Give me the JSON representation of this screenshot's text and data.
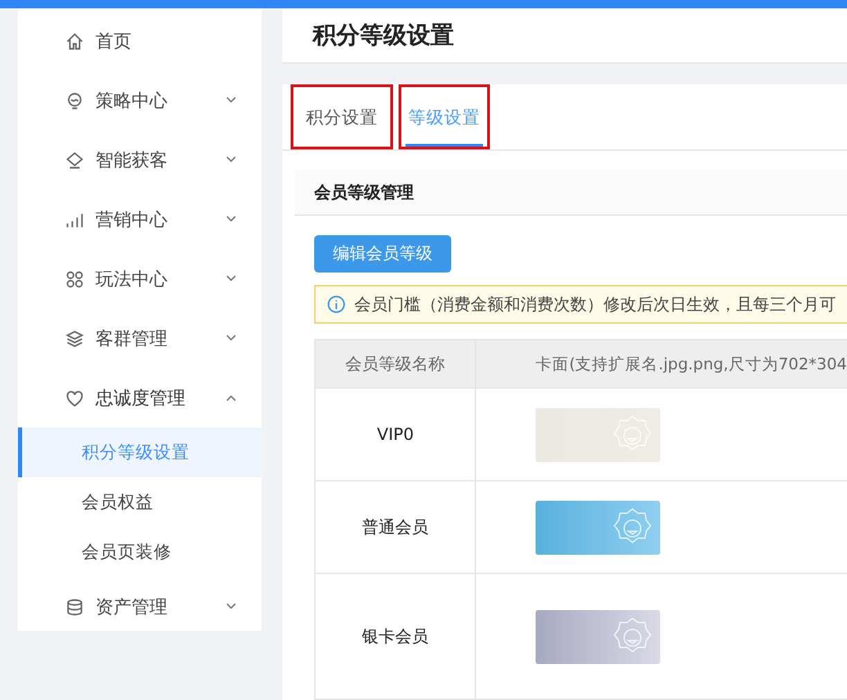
{
  "sidebar": {
    "items": [
      {
        "label": "首页"
      },
      {
        "label": "策略中心",
        "expanded": false
      },
      {
        "label": "智能获客",
        "expanded": false
      },
      {
        "label": "营销中心",
        "expanded": false
      },
      {
        "label": "玩法中心",
        "expanded": false
      },
      {
        "label": "客群管理",
        "expanded": false
      },
      {
        "label": "忠诚度管理",
        "expanded": true,
        "children": [
          {
            "label": "积分等级设置",
            "selected": true
          },
          {
            "label": "会员权益",
            "selected": false
          },
          {
            "label": "会员页装修",
            "selected": false
          }
        ]
      },
      {
        "label": "资产管理",
        "expanded": false
      }
    ]
  },
  "page_title": "积分等级设置",
  "tabs": [
    {
      "label": "积分设置",
      "selected": false,
      "highlighted": true
    },
    {
      "label": "等级设置",
      "selected": true,
      "highlighted": true
    }
  ],
  "section_title": "会员等级管理",
  "edit_button": "编辑会员等级",
  "notice": "会员门槛（消费金额和消费次数）修改后次日生效，且每三个月可",
  "table": {
    "columns": [
      "会员等级名称",
      "卡面(支持扩展名.jpg.png,尺寸为702*304"
    ],
    "rows": [
      {
        "name": "VIP0"
      },
      {
        "name": "普通会员"
      },
      {
        "name": "银卡会员"
      }
    ]
  }
}
